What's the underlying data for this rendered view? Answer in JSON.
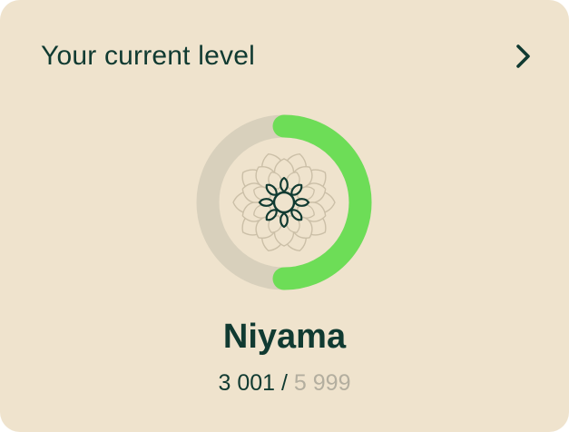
{
  "colors": {
    "card_background": "#efe3cd",
    "text_primary": "#103a31",
    "text_muted": "#b3ae9f",
    "ring_track": "#d8d0bc",
    "progress": "#6ddd57",
    "lotus_outline": "#cbbfa7",
    "flower_center": "#103a31"
  },
  "header": {
    "title": "Your current level",
    "action_icon": "chevron-right-icon"
  },
  "level": {
    "badge_icon": "lotus-mandala-icon",
    "name": "Niyama",
    "current_points": "3 001",
    "separator": " / ",
    "target_points": "5 999",
    "progress_fraction": 0.5
  }
}
